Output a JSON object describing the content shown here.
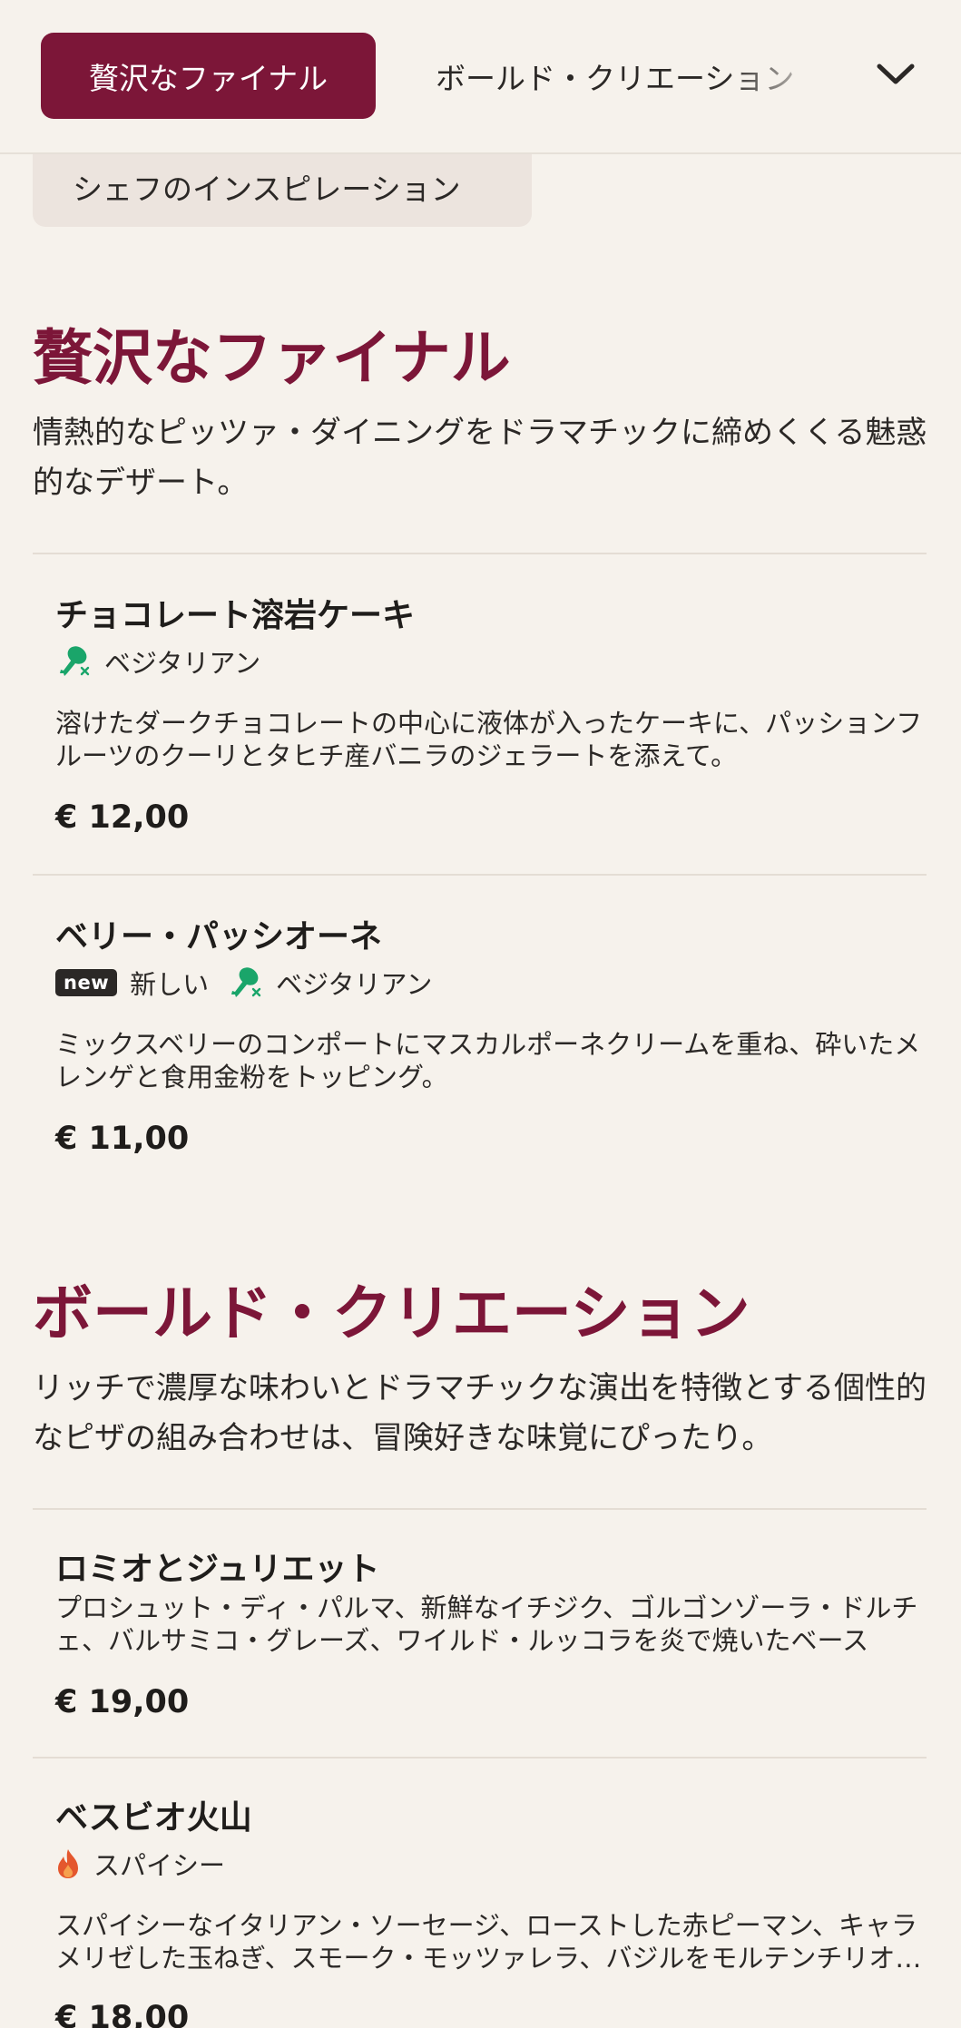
{
  "nav": {
    "active_tab": "贅沢なファイナル",
    "next_tab": "ボールド・クリエーション",
    "hidden_tab": "シェフのインスピレーション",
    "expand_icon": "chevron-down-icon"
  },
  "sections": [
    {
      "title": "贅沢なファイナル",
      "description": "情熱的なピッツァ・ダイニングをドラマチックに締めくくる魅惑的なデザート。",
      "items": [
        {
          "name": "チョコレート溶岩ケーキ",
          "tags": [
            "ベジタリアン"
          ],
          "description": "溶けたダークチョコレートの中心に液体が入ったケーキに、パッションフルーツのクーリとタヒチ産バニラのジェラートを添えて。",
          "price": "€ 12,00"
        },
        {
          "name": "ベリー・パッシオーネ",
          "badge": "new",
          "tags": [
            "新しい",
            "ベジタリアン"
          ],
          "description": "ミックスベリーのコンポートにマスカルポーネクリームを重ね、砕いたメレンゲと食用金粉をトッピング。",
          "price": "€ 11,00"
        }
      ]
    },
    {
      "title": "ボールド・クリエーション",
      "description": "リッチで濃厚な味わいとドラマチックな演出を特徴とする個性的なピザの組み合わせは、冒険好きな味覚にぴったり。",
      "items": [
        {
          "name": "ロミオとジュリエット",
          "description": "プロシュット・ディ・パルマ、新鮮なイチジク、ゴルゴンゾーラ・ドルチェ、バルサミコ・グレーズ、ワイルド・ルッコラを炎で焼いたベース",
          "price": "€ 19,00"
        },
        {
          "name": "ベスビオ火山",
          "tags": [
            "スパイシー"
          ],
          "description": "スパイシーなイタリアン・ソーセージ、ローストした赤ピーマン、キャラメリゼした玉ねぎ、スモーク・モッツァレラ、バジルをモルテンチリオイルで",
          "price": "€ 18,00"
        }
      ]
    }
  ],
  "colors": {
    "background": "#f6f2ec",
    "accent": "#7c1638",
    "vegetarian": "#1aa56a",
    "spicy": "#e4572e",
    "text": "#1f1d1b"
  },
  "icons": {
    "vegetarian": "drumstick-crossed-icon",
    "spicy": "flame-icon"
  }
}
